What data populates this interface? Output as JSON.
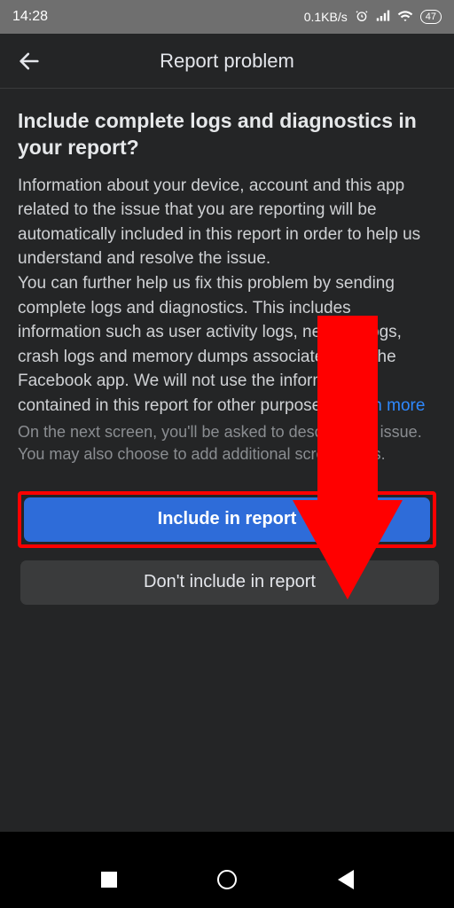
{
  "statusbar": {
    "time": "14:28",
    "speed": "0.1KB/s",
    "battery": "47"
  },
  "header": {
    "title": "Report problem"
  },
  "content": {
    "heading": "Include complete logs and diagnostics in your report?",
    "para1": "Information about your device, account and this app related to the issue that you are reporting will be automatically included in this report in order to help us understand and resolve the issue.",
    "para2_a": "You can further help us fix this problem by sending complete logs and diagnostics. This includes information such as user activity logs, network logs, crash logs and memory dumps associated with the Facebook app. We will not use the information contained in this report for other purposes. ",
    "learn_more": "Learn more",
    "subnote": "On the next screen, you'll be asked to describe the issue. You may also choose to add additional screenshots."
  },
  "buttons": {
    "include": "Include in report",
    "exclude": "Don't include in report"
  }
}
